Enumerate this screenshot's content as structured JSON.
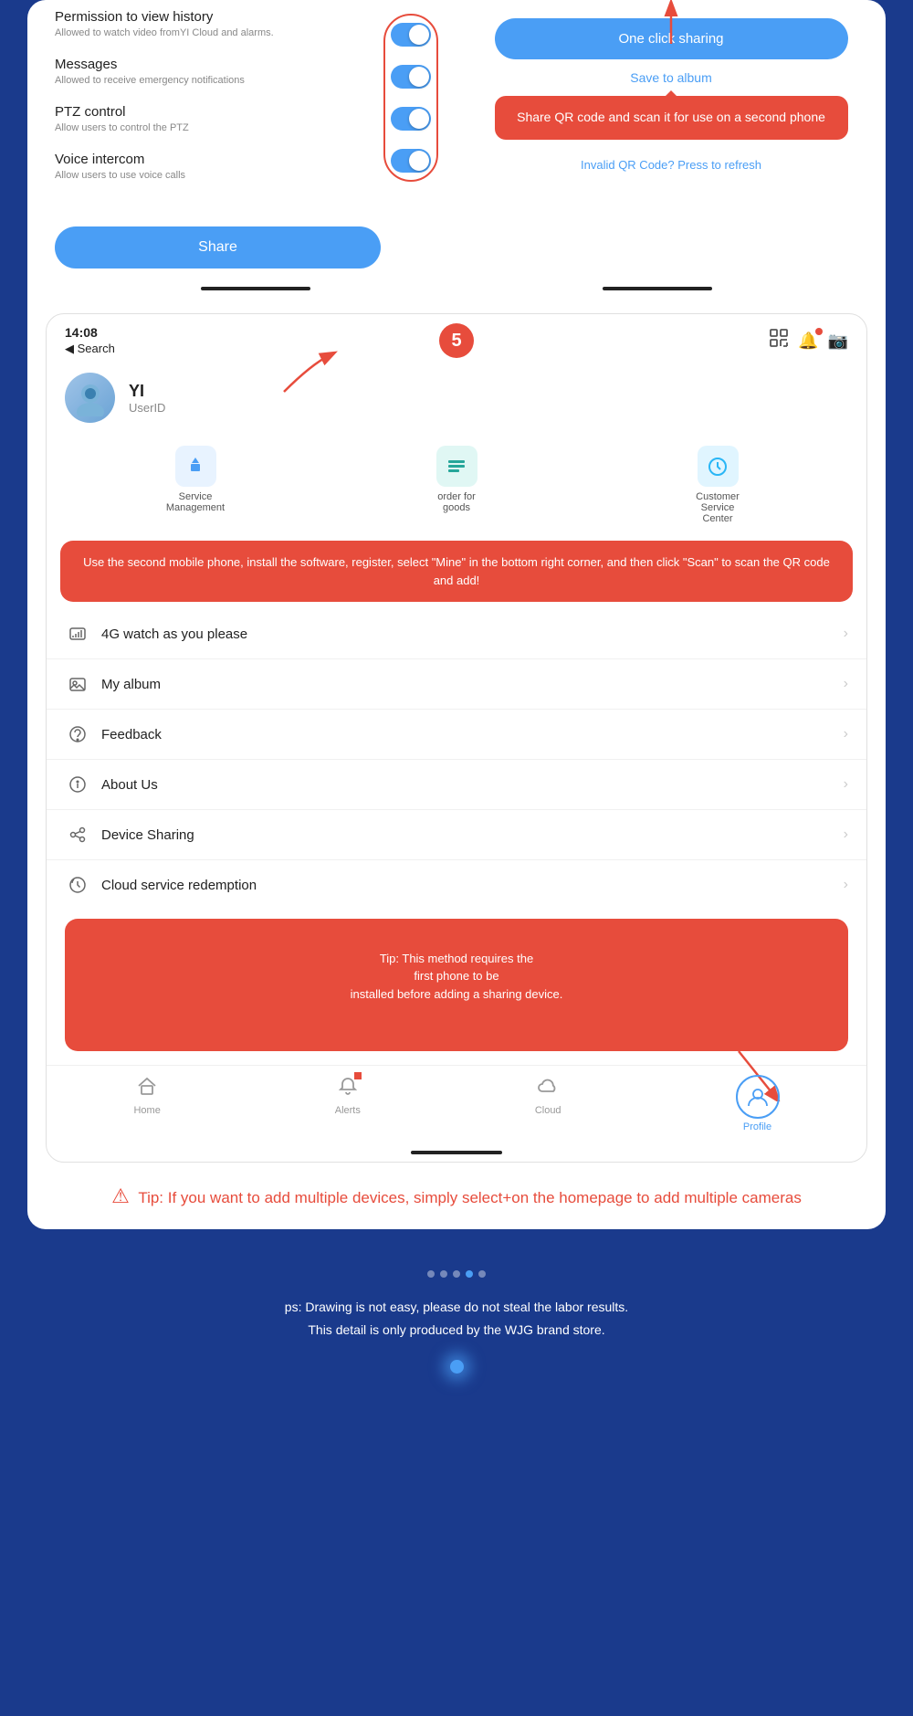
{
  "permissions": {
    "items": [
      {
        "title": "Permission to view history",
        "desc": "Allowed to watch video fromYI Cloud and alarms."
      },
      {
        "title": "Messages",
        "desc": "Allowed to receive emergency notifications"
      },
      {
        "title": "PTZ control",
        "desc": "Allow users to control the PTZ"
      },
      {
        "title": "Voice intercom",
        "desc": "Allow users to use voice calls"
      }
    ],
    "share_button": "Share"
  },
  "qr_panel": {
    "one_click_btn": "One click sharing",
    "save_album": "Save to album",
    "qr_tooltip": "Share QR code and scan it for use on a second phone",
    "invalid_qr": "Invalid QR Code? Press to refresh"
  },
  "phone_screen": {
    "time": "14:08",
    "back": "◀ Search",
    "step_number": "5",
    "profile_name": "YI",
    "profile_userid": "UserID",
    "menu_items": [
      {
        "label": "Service Management",
        "color": "blue",
        "icon": "⬆"
      },
      {
        "label": "order for goods",
        "color": "teal",
        "icon": "☰"
      },
      {
        "label": "Customer Service Center",
        "color": "cyan",
        "icon": "↻"
      }
    ],
    "instruction_tooltip": "Use the second mobile phone, install the software, register, select \"Mine\" in the bottom right corner, and then click \"Scan\" to scan the QR code and add!",
    "list_items": [
      {
        "label": "4G watch as you please",
        "icon": "📊"
      },
      {
        "label": "My album",
        "icon": "🖼"
      },
      {
        "label": "Feedback",
        "icon": "😊"
      },
      {
        "label": "About Us",
        "icon": "ℹ"
      },
      {
        "label": "Device Sharing",
        "icon": "↗"
      },
      {
        "label": "Cloud service redemption",
        "icon": "↻"
      }
    ],
    "tip_tooltip": "Tip: This method requires the\nfirst phone to be\ninstalled before adding a sharing device.",
    "bottom_nav": [
      {
        "label": "Home",
        "icon": "⌂",
        "active": false
      },
      {
        "label": "Alerts",
        "icon": "🔔",
        "active": false,
        "has_dot": true
      },
      {
        "label": "Cloud",
        "icon": "☁",
        "active": false
      },
      {
        "label": "Profile",
        "icon": "👤",
        "active": true
      }
    ]
  },
  "bottom_tip": {
    "text": "Tip: If you want to add multiple devices, simply select+on the homepage to add multiple cameras"
  },
  "footer": {
    "text1": "ps: Drawing is not easy, please do not steal the labor results.",
    "text2": "This detail is only produced by the WJG brand store."
  },
  "colors": {
    "accent_blue": "#4a9ef5",
    "accent_red": "#e74c3c",
    "bg_dark": "#1a3a8c",
    "text_dark": "#222",
    "text_gray": "#888"
  }
}
